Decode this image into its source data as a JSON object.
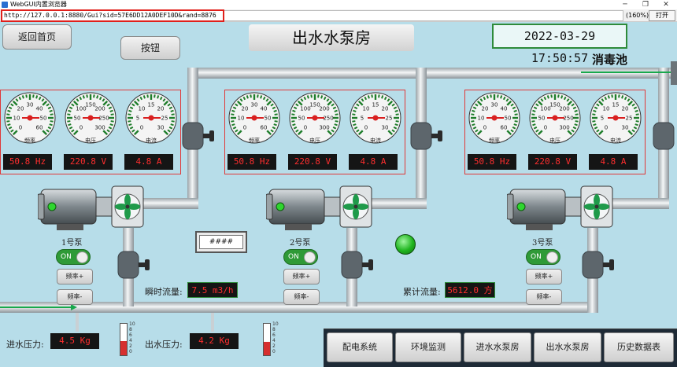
{
  "window": {
    "title": "WebGUI内置浏览器",
    "minimize": "─",
    "restore": "❐",
    "close": "✕"
  },
  "address": {
    "url": "http://127.0.0.1:8880/Gui?sid=57E6DD12A0DEF10D&rand=8876",
    "zoom": "(160%)",
    "open_button": "打开"
  },
  "header": {
    "back_button": "返回首页",
    "action_button": "按钮",
    "page_title": "出水水泵房",
    "datetime": "2022-03-29 17:50:57",
    "tank_label": "消毒池"
  },
  "dial_captions": [
    "频率",
    "电压",
    "电流"
  ],
  "pumps": [
    {
      "name": "1号泵",
      "frequency": "50.8 Hz",
      "voltage": "220.8 V",
      "current": "4.8 A",
      "toggle": "ON",
      "freq_up": "频率+",
      "freq_down": "频率-"
    },
    {
      "name": "2号泵",
      "frequency": "50.8 Hz",
      "voltage": "220.8 V",
      "current": "4.8 A",
      "toggle": "ON",
      "freq_up": "频率+",
      "freq_down": "频率-"
    },
    {
      "name": "3号泵",
      "frequency": "50.8 Hz",
      "voltage": "220.8 V",
      "current": "4.8 A",
      "toggle": "ON",
      "freq_up": "频率+",
      "freq_down": "频率-"
    }
  ],
  "flow": {
    "instant_label": "瞬时流量:",
    "instant_value": "7.5 m3/h",
    "total_label": "累计流量:",
    "total_value": "5612.0 方",
    "placeholder": "####"
  },
  "pressure": {
    "inlet_label": "进水压力:",
    "inlet_value": "4.5 Kg",
    "outlet_label": "出水压力:",
    "outlet_value": "4.2 Kg",
    "scale": [
      "10",
      "8",
      "6",
      "4",
      "2",
      "0"
    ],
    "inlet_level": 0.45,
    "outlet_level": 0.42
  },
  "nav": [
    "配电系统",
    "环境监测",
    "进水水泵房",
    "出水水泵房",
    "历史数据表"
  ],
  "colors": {
    "background": "#b7dde9",
    "readout_text": "#ff2e2e",
    "run_green": "#2f9a37",
    "panel_border": "#e03838"
  }
}
